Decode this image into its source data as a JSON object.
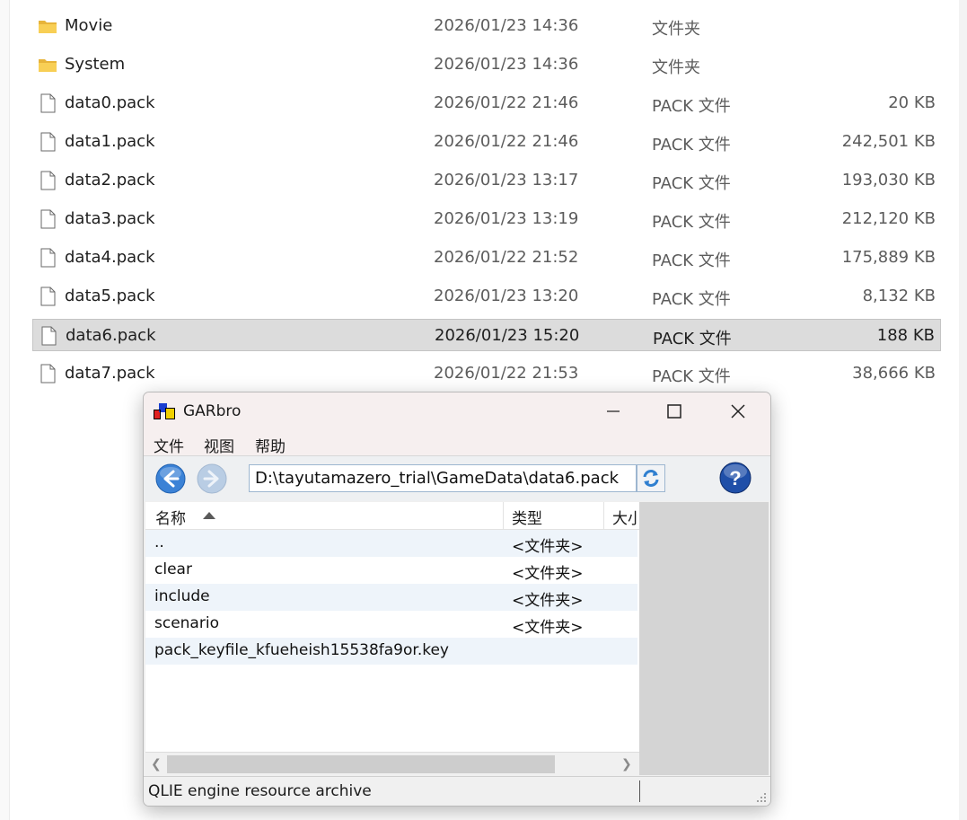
{
  "explorer": {
    "files": [
      {
        "name": "Movie",
        "date": "2026/01/23 14:36",
        "type": "文件夹",
        "size": "",
        "icon": "folder-icon"
      },
      {
        "name": "System",
        "date": "2026/01/23 14:36",
        "type": "文件夹",
        "size": "",
        "icon": "folder-icon"
      },
      {
        "name": "data0.pack",
        "date": "2026/01/22 21:46",
        "type": "PACK 文件",
        "size": "20 KB",
        "icon": "file-icon"
      },
      {
        "name": "data1.pack",
        "date": "2026/01/22 21:46",
        "type": "PACK 文件",
        "size": "242,501 KB",
        "icon": "file-icon"
      },
      {
        "name": "data2.pack",
        "date": "2026/01/23 13:17",
        "type": "PACK 文件",
        "size": "193,030 KB",
        "icon": "file-icon"
      },
      {
        "name": "data3.pack",
        "date": "2026/01/23 13:19",
        "type": "PACK 文件",
        "size": "212,120 KB",
        "icon": "file-icon"
      },
      {
        "name": "data4.pack",
        "date": "2026/01/22 21:52",
        "type": "PACK 文件",
        "size": "175,889 KB",
        "icon": "file-icon"
      },
      {
        "name": "data5.pack",
        "date": "2026/01/23 13:20",
        "type": "PACK 文件",
        "size": "8,132 KB",
        "icon": "file-icon"
      },
      {
        "name": "data6.pack",
        "date": "2026/01/23 15:20",
        "type": "PACK 文件",
        "size": "188 KB",
        "icon": "file-icon",
        "selected": true
      },
      {
        "name": "data7.pack",
        "date": "2026/01/22 21:53",
        "type": "PACK 文件",
        "size": "38,666 KB",
        "icon": "file-icon"
      }
    ]
  },
  "garbro": {
    "title": "GARbro",
    "menu": [
      "文件",
      "视图",
      "帮助"
    ],
    "address": "D:\\tayutamazero_trial\\GameData\\data6.pack",
    "columns": {
      "name": "名称",
      "type": "类型",
      "size": "大小"
    },
    "entries": [
      {
        "name": "..",
        "type": "<文件夹>"
      },
      {
        "name": "clear",
        "type": "<文件夹>"
      },
      {
        "name": "include",
        "type": "<文件夹>"
      },
      {
        "name": "scenario",
        "type": "<文件夹>"
      },
      {
        "name": "pack_keyfile_kfueheish15538fa9or.key",
        "type": ""
      }
    ],
    "status": "QLIE engine resource archive"
  },
  "colors": {
    "selection": "#dcdcdc",
    "folder": "#f5c542",
    "nav_blue": "#3b82d6",
    "help_blue": "#1f4fa8"
  }
}
